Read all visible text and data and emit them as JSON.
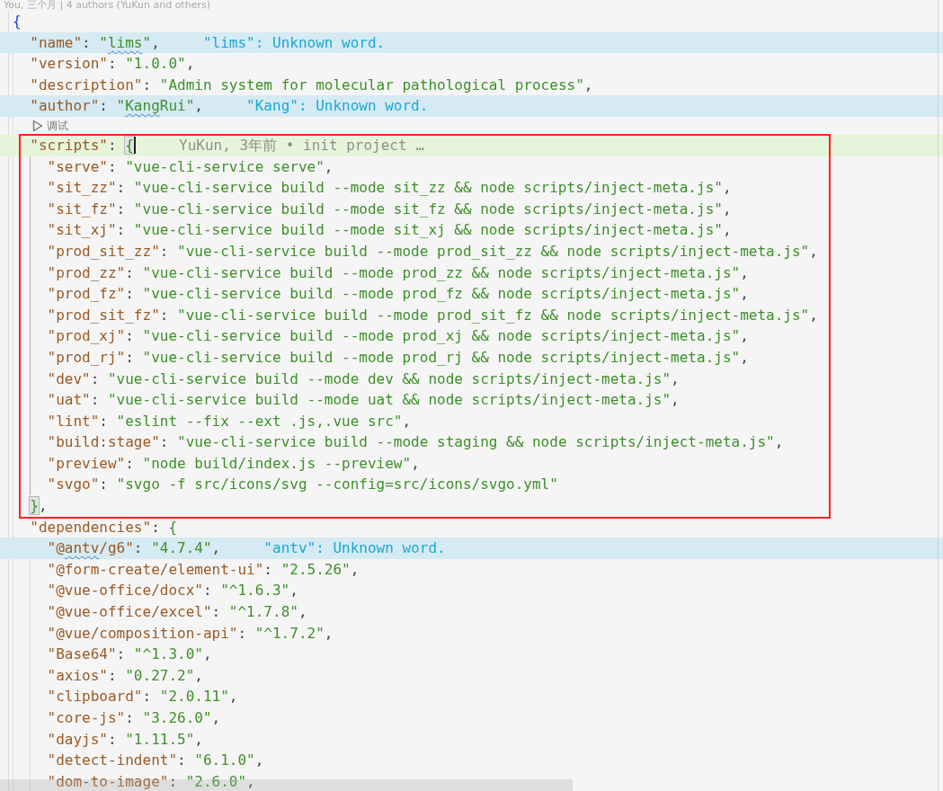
{
  "editor": {
    "blame_header": "You, 三个月 | 4 authors (YuKun and others)",
    "lines": [
      {
        "kind": "line",
        "tokens": [
          {
            "kind": "bracket",
            "text": "{"
          }
        ],
        "children": [
          {
            "kind": "line",
            "diagnostic": "\"lims\": Unknown word.",
            "tokens": [
              {
                "kind": "key",
                "text": "\"name\""
              },
              {
                "kind": "punct",
                "text": ": "
              },
              {
                "kind": "string",
                "text": "\""
              },
              {
                "kind": "stringtypo",
                "text": "lims"
              },
              {
                "kind": "string",
                "text": "\""
              },
              {
                "kind": "punct",
                "text": ","
              }
            ]
          },
          {
            "kind": "line",
            "tokens": [
              {
                "kind": "key",
                "text": "\"version\""
              },
              {
                "kind": "punct",
                "text": ": "
              },
              {
                "kind": "string",
                "text": "\"1.0.0\""
              },
              {
                "kind": "punct",
                "text": ","
              }
            ]
          },
          {
            "kind": "line",
            "tokens": [
              {
                "kind": "key",
                "text": "\"description\""
              },
              {
                "kind": "punct",
                "text": ": "
              },
              {
                "kind": "string",
                "text": "\"Admin system for molecular pathological process\""
              },
              {
                "kind": "punct",
                "text": ","
              }
            ]
          },
          {
            "kind": "line",
            "diagnostic": "\"Kang\": Unknown word.",
            "tokens": [
              {
                "kind": "key",
                "text": "\"author\""
              },
              {
                "kind": "punct",
                "text": ": "
              },
              {
                "kind": "string",
                "text": "\""
              },
              {
                "kind": "stringtypo",
                "text": "Kang"
              },
              {
                "kind": "string",
                "text": "Rui\""
              },
              {
                "kind": "punct",
                "text": ","
              }
            ]
          },
          {
            "kind": "codelens",
            "text": "调试"
          },
          {
            "kind": "line",
            "boxed": true,
            "blame": "YuKun, 3年前 • init project …",
            "tokens": [
              {
                "kind": "key",
                "text": "\"scripts\""
              },
              {
                "kind": "punct",
                "text": ": "
              },
              {
                "kind": "matched",
                "text": "{"
              }
            ],
            "close": [
              {
                "kind": "matched",
                "text": "}"
              },
              {
                "kind": "punct",
                "text": ","
              }
            ],
            "children": [
              {
                "kind": "line",
                "tokens": [
                  {
                    "kind": "key",
                    "text": "\"serve\""
                  },
                  {
                    "kind": "punct",
                    "text": ": "
                  },
                  {
                    "kind": "string",
                    "text": "\"vue-cli-service serve\""
                  },
                  {
                    "kind": "punct",
                    "text": ","
                  }
                ]
              },
              {
                "kind": "line",
                "tokens": [
                  {
                    "kind": "key",
                    "text": "\"sit_zz\""
                  },
                  {
                    "kind": "punct",
                    "text": ": "
                  },
                  {
                    "kind": "string",
                    "text": "\"vue-cli-service build --mode sit_zz && node scripts/inject-meta.js\""
                  },
                  {
                    "kind": "punct",
                    "text": ","
                  }
                ]
              },
              {
                "kind": "line",
                "tokens": [
                  {
                    "kind": "key",
                    "text": "\"sit_fz\""
                  },
                  {
                    "kind": "punct",
                    "text": ": "
                  },
                  {
                    "kind": "string",
                    "text": "\"vue-cli-service build --mode sit_fz && node scripts/inject-meta.js\""
                  },
                  {
                    "kind": "punct",
                    "text": ","
                  }
                ]
              },
              {
                "kind": "line",
                "tokens": [
                  {
                    "kind": "key",
                    "text": "\"sit_xj\""
                  },
                  {
                    "kind": "punct",
                    "text": ": "
                  },
                  {
                    "kind": "string",
                    "text": "\"vue-cli-service build --mode sit_xj && node scripts/inject-meta.js\""
                  },
                  {
                    "kind": "punct",
                    "text": ","
                  }
                ]
              },
              {
                "kind": "line",
                "tokens": [
                  {
                    "kind": "key",
                    "text": "\"prod_sit_zz\""
                  },
                  {
                    "kind": "punct",
                    "text": ": "
                  },
                  {
                    "kind": "string",
                    "text": "\"vue-cli-service build --mode prod_sit_zz && node scripts/inject-meta.js\""
                  },
                  {
                    "kind": "punct",
                    "text": ","
                  }
                ]
              },
              {
                "kind": "line",
                "tokens": [
                  {
                    "kind": "key",
                    "text": "\"prod_zz\""
                  },
                  {
                    "kind": "punct",
                    "text": ": "
                  },
                  {
                    "kind": "string",
                    "text": "\"vue-cli-service build --mode prod_zz && node scripts/inject-meta.js\""
                  },
                  {
                    "kind": "punct",
                    "text": ","
                  }
                ]
              },
              {
                "kind": "line",
                "tokens": [
                  {
                    "kind": "key",
                    "text": "\"prod_fz\""
                  },
                  {
                    "kind": "punct",
                    "text": ": "
                  },
                  {
                    "kind": "string",
                    "text": "\"vue-cli-service build --mode prod_fz && node scripts/inject-meta.js\""
                  },
                  {
                    "kind": "punct",
                    "text": ","
                  }
                ]
              },
              {
                "kind": "line",
                "tokens": [
                  {
                    "kind": "key",
                    "text": "\"prod_sit_fz\""
                  },
                  {
                    "kind": "punct",
                    "text": ": "
                  },
                  {
                    "kind": "string",
                    "text": "\"vue-cli-service build --mode prod_sit_fz && node scripts/inject-meta.js\""
                  },
                  {
                    "kind": "punct",
                    "text": ","
                  }
                ]
              },
              {
                "kind": "line",
                "tokens": [
                  {
                    "kind": "key",
                    "text": "\"prod_xj\""
                  },
                  {
                    "kind": "punct",
                    "text": ": "
                  },
                  {
                    "kind": "string",
                    "text": "\"vue-cli-service build --mode prod_xj && node scripts/inject-meta.js\""
                  },
                  {
                    "kind": "punct",
                    "text": ","
                  }
                ]
              },
              {
                "kind": "line",
                "tokens": [
                  {
                    "kind": "key",
                    "text": "\"prod_rj\""
                  },
                  {
                    "kind": "punct",
                    "text": ": "
                  },
                  {
                    "kind": "string",
                    "text": "\"vue-cli-service build --mode prod_rj && node scripts/inject-meta.js\""
                  },
                  {
                    "kind": "punct",
                    "text": ","
                  }
                ]
              },
              {
                "kind": "line",
                "tokens": [
                  {
                    "kind": "key",
                    "text": "\"dev\""
                  },
                  {
                    "kind": "punct",
                    "text": ": "
                  },
                  {
                    "kind": "string",
                    "text": "\"vue-cli-service build --mode dev && node scripts/inject-meta.js\""
                  },
                  {
                    "kind": "punct",
                    "text": ","
                  }
                ]
              },
              {
                "kind": "line",
                "tokens": [
                  {
                    "kind": "key",
                    "text": "\"uat\""
                  },
                  {
                    "kind": "punct",
                    "text": ": "
                  },
                  {
                    "kind": "string",
                    "text": "\"vue-cli-service build --mode uat && node scripts/inject-meta.js\""
                  },
                  {
                    "kind": "punct",
                    "text": ","
                  }
                ]
              },
              {
                "kind": "line",
                "tokens": [
                  {
                    "kind": "key",
                    "text": "\"lint\""
                  },
                  {
                    "kind": "punct",
                    "text": ": "
                  },
                  {
                    "kind": "string",
                    "text": "\"eslint --fix --ext .js,.vue src\""
                  },
                  {
                    "kind": "punct",
                    "text": ","
                  }
                ]
              },
              {
                "kind": "line",
                "tokens": [
                  {
                    "kind": "key",
                    "text": "\"build:stage\""
                  },
                  {
                    "kind": "punct",
                    "text": ": "
                  },
                  {
                    "kind": "string",
                    "text": "\"vue-cli-service build --mode staging && node scripts/inject-meta.js\""
                  },
                  {
                    "kind": "punct",
                    "text": ","
                  }
                ]
              },
              {
                "kind": "line",
                "tokens": [
                  {
                    "kind": "key",
                    "text": "\"preview\""
                  },
                  {
                    "kind": "punct",
                    "text": ": "
                  },
                  {
                    "kind": "string",
                    "text": "\"node build/index.js --preview\""
                  },
                  {
                    "kind": "punct",
                    "text": ","
                  }
                ]
              },
              {
                "kind": "line",
                "tokens": [
                  {
                    "kind": "key",
                    "text": "\"svgo\""
                  },
                  {
                    "kind": "punct",
                    "text": ": "
                  },
                  {
                    "kind": "string",
                    "text": "\"svgo -f src/icons/svg --config=src/icons/svgo.yml\""
                  }
                ]
              }
            ]
          },
          {
            "kind": "line",
            "tokens": [
              {
                "kind": "key",
                "text": "\"dependencies\""
              },
              {
                "kind": "punct",
                "text": ": "
              },
              {
                "kind": "subbracket",
                "text": "{"
              }
            ],
            "children": [
              {
                "kind": "line",
                "diagnostic": "\"antv\": Unknown word.",
                "tokens": [
                  {
                    "kind": "key",
                    "text": "\"@"
                  },
                  {
                    "kind": "keytypo",
                    "text": "antv"
                  },
                  {
                    "kind": "key",
                    "text": "/g6\""
                  },
                  {
                    "kind": "punct",
                    "text": ": "
                  },
                  {
                    "kind": "string",
                    "text": "\"4.7.4\""
                  },
                  {
                    "kind": "punct",
                    "text": ","
                  }
                ]
              },
              {
                "kind": "line",
                "tokens": [
                  {
                    "kind": "key",
                    "text": "\"@form-create/element-ui\""
                  },
                  {
                    "kind": "punct",
                    "text": ": "
                  },
                  {
                    "kind": "string",
                    "text": "\"2.5.26\""
                  },
                  {
                    "kind": "punct",
                    "text": ","
                  }
                ]
              },
              {
                "kind": "line",
                "tokens": [
                  {
                    "kind": "key",
                    "text": "\"@vue-office/docx\""
                  },
                  {
                    "kind": "punct",
                    "text": ": "
                  },
                  {
                    "kind": "string",
                    "text": "\"^1.6.3\""
                  },
                  {
                    "kind": "punct",
                    "text": ","
                  }
                ]
              },
              {
                "kind": "line",
                "tokens": [
                  {
                    "kind": "key",
                    "text": "\"@vue-office/excel\""
                  },
                  {
                    "kind": "punct",
                    "text": ": "
                  },
                  {
                    "kind": "string",
                    "text": "\"^1.7.8\""
                  },
                  {
                    "kind": "punct",
                    "text": ","
                  }
                ]
              },
              {
                "kind": "line",
                "tokens": [
                  {
                    "kind": "key",
                    "text": "\"@vue/composition-api\""
                  },
                  {
                    "kind": "punct",
                    "text": ": "
                  },
                  {
                    "kind": "string",
                    "text": "\"^1.7.2\""
                  },
                  {
                    "kind": "punct",
                    "text": ","
                  }
                ]
              },
              {
                "kind": "line",
                "tokens": [
                  {
                    "kind": "key",
                    "text": "\"Base64\""
                  },
                  {
                    "kind": "punct",
                    "text": ": "
                  },
                  {
                    "kind": "string",
                    "text": "\"^1.3.0\""
                  },
                  {
                    "kind": "punct",
                    "text": ","
                  }
                ]
              },
              {
                "kind": "line",
                "tokens": [
                  {
                    "kind": "key",
                    "text": "\"axios\""
                  },
                  {
                    "kind": "punct",
                    "text": ": "
                  },
                  {
                    "kind": "string",
                    "text": "\"0.27.2\""
                  },
                  {
                    "kind": "punct",
                    "text": ","
                  }
                ]
              },
              {
                "kind": "line",
                "tokens": [
                  {
                    "kind": "key",
                    "text": "\"clipboard\""
                  },
                  {
                    "kind": "punct",
                    "text": ": "
                  },
                  {
                    "kind": "string",
                    "text": "\"2.0.11\""
                  },
                  {
                    "kind": "punct",
                    "text": ","
                  }
                ]
              },
              {
                "kind": "line",
                "tokens": [
                  {
                    "kind": "key",
                    "text": "\"core-js\""
                  },
                  {
                    "kind": "punct",
                    "text": ": "
                  },
                  {
                    "kind": "string",
                    "text": "\"3.26.0\""
                  },
                  {
                    "kind": "punct",
                    "text": ","
                  }
                ]
              },
              {
                "kind": "line",
                "tokens": [
                  {
                    "kind": "key",
                    "text": "\"dayjs\""
                  },
                  {
                    "kind": "punct",
                    "text": ": "
                  },
                  {
                    "kind": "string",
                    "text": "\"1.11.5\""
                  },
                  {
                    "kind": "punct",
                    "text": ","
                  }
                ]
              },
              {
                "kind": "line",
                "tokens": [
                  {
                    "kind": "key",
                    "text": "\"detect-indent\""
                  },
                  {
                    "kind": "punct",
                    "text": ": "
                  },
                  {
                    "kind": "string",
                    "text": "\"6.1.0\""
                  },
                  {
                    "kind": "punct",
                    "text": ","
                  }
                ]
              },
              {
                "kind": "line",
                "tokens": [
                  {
                    "kind": "key",
                    "text": "\"dom-to-image\""
                  },
                  {
                    "kind": "punct",
                    "text": ": "
                  },
                  {
                    "kind": "string",
                    "text": "\"2.6.0\""
                  },
                  {
                    "kind": "punct",
                    "text": ","
                  }
                ]
              }
            ]
          }
        ]
      }
    ]
  }
}
